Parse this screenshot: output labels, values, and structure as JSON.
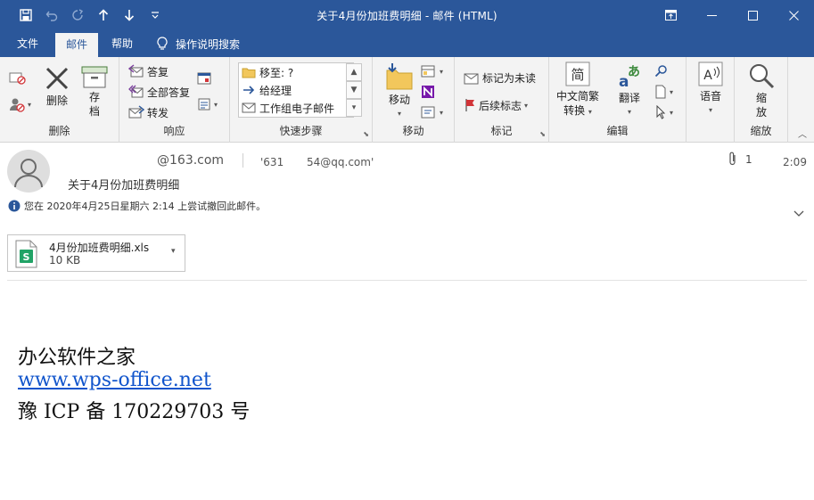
{
  "window": {
    "title": "关于4月份加班费明细  -  邮件 (HTML)"
  },
  "menu": {
    "tabs": [
      {
        "label": "文件"
      },
      {
        "label": "邮件"
      },
      {
        "label": "帮助"
      }
    ],
    "tell_me": "操作说明搜索"
  },
  "ribbon": {
    "delete_group": {
      "delete": "删除",
      "archive_1": "存",
      "archive_2": "档",
      "label": "删除"
    },
    "respond_group": {
      "reply": "答复",
      "reply_all": "全部答复",
      "forward": "转发",
      "label": "响应"
    },
    "quick_steps": {
      "items": [
        {
          "label": "移至: ?"
        },
        {
          "label": "给经理"
        },
        {
          "label": "工作组电子邮件"
        }
      ],
      "label": "快速步骤"
    },
    "move_group": {
      "move": "移动",
      "label": "移动"
    },
    "tags_group": {
      "mark_unread": "标记为未读",
      "follow_up": "后续标志",
      "label": "标记"
    },
    "editing_group": {
      "convert_1": "中文简繁",
      "convert_2": "转换",
      "convert_icon_glyph": "简",
      "translate": "翻译",
      "translate_icon_a": "a",
      "translate_icon_b": "あ",
      "label": "编辑"
    },
    "speech_group": {
      "speech": "语音",
      "speech_icon_glyph": "A",
      "label": ""
    },
    "zoom_group": {
      "zoom_1": "缩",
      "zoom_2": "放",
      "label": "缩放"
    }
  },
  "message": {
    "from": "@163.com",
    "to_1": "'631",
    "to_2": "54@qq.com'",
    "subject": "关于4月份加班费明细",
    "attachment_count": "1",
    "time": "2:09",
    "info": "您在 2020年4月25日星期六 2:14 上尝试撤回此邮件。",
    "attachment": {
      "name": "4月份加班费明细.xls",
      "size": "10 KB",
      "icon_letter": "S"
    },
    "body": {
      "line1": "办公软件之家",
      "link": "www.wps-office.net",
      "line3": "豫 ICP 备 170229703 号"
    }
  },
  "colors": {
    "accent": "#2b579a",
    "ribbon_bg": "#f3f3f3",
    "link": "#1155cc"
  },
  "icons": [
    "save-icon",
    "undo-icon",
    "redo-icon",
    "up-arrow-icon",
    "down-arrow-icon",
    "customize-icon",
    "restore-icon",
    "minimize-icon",
    "maximize-icon",
    "close-icon",
    "lightbulb-icon",
    "delete-icon",
    "archive-icon",
    "reply-icon",
    "reply-all-icon",
    "forward-icon",
    "move-icon",
    "onenote-icon",
    "tag-icon",
    "flag-icon",
    "translate-icon",
    "speech-icon",
    "zoom-icon",
    "paperclip-icon",
    "info-icon",
    "excel-file-icon"
  ]
}
